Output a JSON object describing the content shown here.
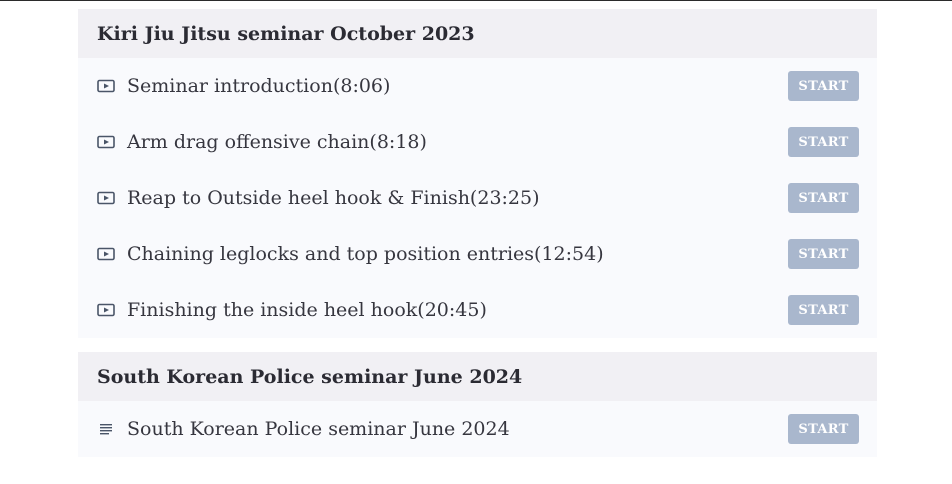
{
  "sections": [
    {
      "title": "Kiri Jiu Jitsu seminar October 2023",
      "lessons": [
        {
          "icon": "video-icon",
          "title": "Seminar introduction(8:06)",
          "button": "START"
        },
        {
          "icon": "video-icon",
          "title": "Arm drag offensive chain(8:18)",
          "button": "START"
        },
        {
          "icon": "video-icon",
          "title": "Reap to Outside heel hook & Finish(23:25)",
          "button": "START"
        },
        {
          "icon": "video-icon",
          "title": "Chaining leglocks and top position entries(12:54)",
          "button": "START"
        },
        {
          "icon": "video-icon",
          "title": "Finishing the inside heel hook(20:45)",
          "button": "START"
        }
      ]
    },
    {
      "title": "South Korean Police seminar June 2024",
      "lessons": [
        {
          "icon": "text-icon",
          "title": "South Korean Police seminar June 2024",
          "button": "START"
        }
      ]
    }
  ],
  "colors": {
    "header_bg": "#f1f0f4",
    "list_bg": "#f9fafd",
    "button_bg": "#a9b7cd",
    "icon": "#4a5568"
  }
}
